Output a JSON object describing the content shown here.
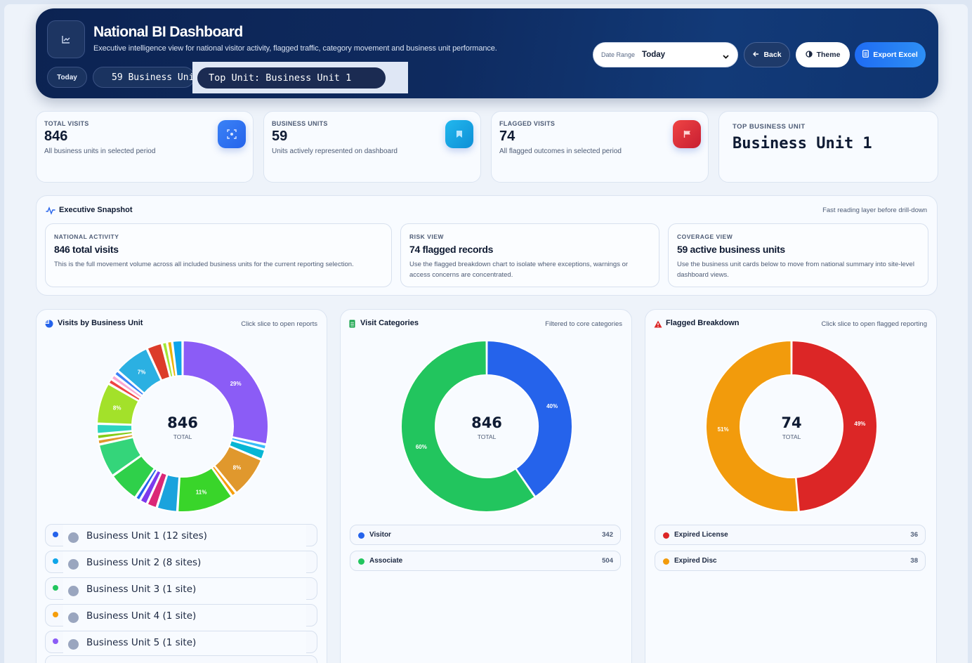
{
  "header": {
    "title": "National BI Dashboard",
    "subtitle": "Executive intelligence view for national visitor activity, flagged traffic, category movement and business unit performance.",
    "pill_today": "Today",
    "pill_units": "59 Business Unit",
    "pill_top_unit": "Top Unit: Business Unit 1",
    "date_range_label": "Date Range",
    "date_range_value": "Today",
    "back_label": "Back",
    "theme_label": "Theme",
    "export_label": "Export Excel",
    "logo_icon": "chart-icon"
  },
  "kpis": [
    {
      "label": "TOTAL VISITS",
      "value": "846",
      "desc": "All business units in selected period",
      "icon": "scan-icon",
      "color": "#2f6ff2"
    },
    {
      "label": "BUSINESS UNITS",
      "value": "59",
      "desc": "Units actively represented on dashboard",
      "icon": "bookmark-icon",
      "color": "#13a7e6"
    },
    {
      "label": "FLAGGED VISITS",
      "value": "74",
      "desc": "All flagged outcomes in selected period",
      "icon": "flag-icon",
      "color": "#d8283a"
    }
  ],
  "top_unit": {
    "label": "TOP BUSINESS UNIT",
    "value": "Business Unit 1"
  },
  "snapshot": {
    "title": "Executive Snapshot",
    "hint": "Fast reading layer before drill-down",
    "cards": [
      {
        "label": "NATIONAL ACTIVITY",
        "headline": "846 total visits",
        "body": "This is the full movement volume across all included business units for the current reporting selection."
      },
      {
        "label": "RISK VIEW",
        "headline": "74 flagged records",
        "body": "Use the flagged breakdown chart to isolate where exceptions, warnings or access concerns are concentrated."
      },
      {
        "label": "COVERAGE VIEW",
        "headline": "59 active business units",
        "body": "Use the business unit cards below to move from national summary into site-level dashboard views."
      }
    ]
  },
  "charts": {
    "business_unit": {
      "title": "Visits by Business Unit",
      "hint": "Click slice to open reports",
      "total": "846",
      "total_label": "TOTAL"
    },
    "categories": {
      "title": "Visit Categories",
      "hint": "Filtered to core categories",
      "total": "846",
      "total_label": "TOTAL"
    },
    "flagged": {
      "title": "Flagged Breakdown",
      "hint": "Click slice to open flagged reporting",
      "total": "74",
      "total_label": "TOTAL"
    }
  },
  "chart_data": [
    {
      "type": "pie",
      "title": "Visits by Business Unit",
      "center_value": 846,
      "slices": [
        {
          "pct": 29,
          "color": "#8b5cf6",
          "label": "29%"
        },
        {
          "pct": 1,
          "color": "#38bdf8"
        },
        {
          "pct": 2,
          "color": "#06b6d4"
        },
        {
          "pct": 8,
          "color": "#e0982d",
          "label": "8%"
        },
        {
          "pct": 1,
          "color": "#f59e0b"
        },
        {
          "pct": 11,
          "color": "#39d52a",
          "label": "11%"
        },
        {
          "pct": 4,
          "color": "#1aa3dd"
        },
        {
          "pct": 2,
          "color": "#db2777"
        },
        {
          "pct": 1.5,
          "color": "#7c3aed"
        },
        {
          "pct": 1,
          "color": "#2563eb"
        },
        {
          "pct": 6,
          "color": "#2fd04a"
        },
        {
          "pct": 6.5,
          "color": "#34d57a"
        },
        {
          "pct": 1,
          "color": "#e0982d"
        },
        {
          "pct": 1,
          "color": "#84cc16"
        },
        {
          "pct": 2,
          "color": "#2dd4bf"
        },
        {
          "pct": 8,
          "color": "#a3e12a",
          "label": "8%"
        },
        {
          "pct": 1,
          "color": "#ef4444"
        },
        {
          "pct": 1,
          "color": "#f9a8d4"
        },
        {
          "pct": 1,
          "color": "#3b82f6"
        },
        {
          "pct": 7,
          "color": "#2bb0e2",
          "label": "7%"
        },
        {
          "pct": 3,
          "color": "#dc3c2a"
        },
        {
          "pct": 1,
          "color": "#a3e635"
        },
        {
          "pct": 1,
          "color": "#eab308"
        },
        {
          "pct": 2,
          "color": "#0ea5e9"
        }
      ]
    },
    {
      "type": "pie",
      "title": "Visit Categories",
      "center_value": 846,
      "slices": [
        {
          "name": "Visitor",
          "value": 342,
          "color": "#2563eb",
          "label": "40%"
        },
        {
          "name": "Associate",
          "value": 504,
          "color": "#22c55e",
          "label": "60%"
        }
      ]
    },
    {
      "type": "pie",
      "title": "Flagged Breakdown",
      "center_value": 74,
      "slices": [
        {
          "name": "Expired License",
          "value": 36,
          "color": "#dc2626",
          "label": "49%"
        },
        {
          "name": "Expired Disc",
          "value": 38,
          "color": "#f29b0c",
          "label": "51%"
        }
      ]
    }
  ],
  "business_units": [
    {
      "name": "Business Unit 1 (12 sites)",
      "color": "#2563eb"
    },
    {
      "name": "Business Unit 2 (8 sites)",
      "color": "#0ea5e9"
    },
    {
      "name": "Business Unit 3 (1 site)",
      "color": "#22c55e"
    },
    {
      "name": "Business Unit 4 (1 site)",
      "color": "#f59e0b"
    },
    {
      "name": "Business Unit 5 (1 site)",
      "color": "#8b5cf6"
    },
    {
      "name": "",
      "color": "#ef4444"
    }
  ]
}
